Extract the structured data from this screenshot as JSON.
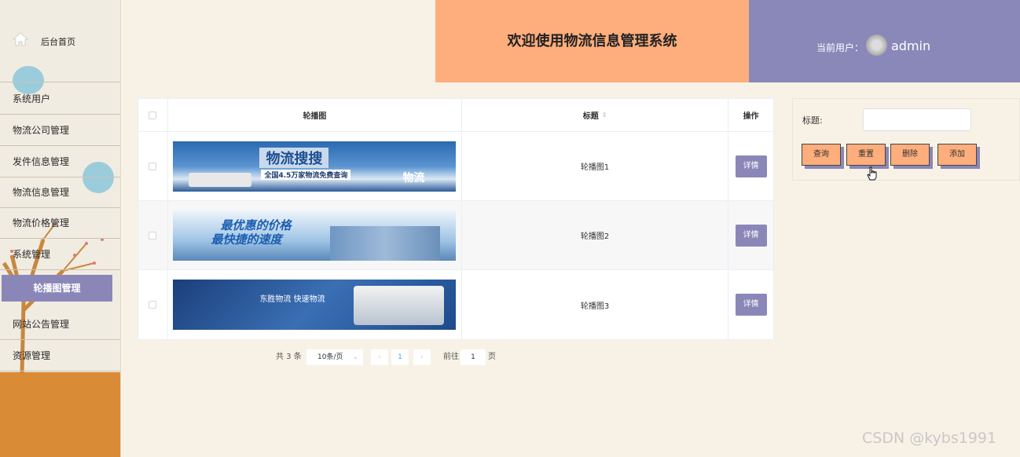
{
  "sidebar": {
    "home_label": "后台首页",
    "items": [
      {
        "label": "系统用户"
      },
      {
        "label": "物流公司管理"
      },
      {
        "label": "发件信息管理"
      },
      {
        "label": "物流信息管理"
      },
      {
        "label": "物流价格管理"
      },
      {
        "label": "系统管理"
      },
      {
        "label": "轮播图管理"
      },
      {
        "label": "网站公告管理"
      },
      {
        "label": "资源管理"
      }
    ]
  },
  "header": {
    "title": "欢迎使用物流信息管理系统",
    "user_label": "当前用户：",
    "username": "admin"
  },
  "table": {
    "columns": {
      "image": "轮播图",
      "title": "标题",
      "action": "操作"
    },
    "rows": [
      {
        "title": "轮播图1",
        "detail": "详情",
        "banner_text": "物流搜搜",
        "banner_sub": "全国4.5万家物流免费查询",
        "banner_tag": "物流"
      },
      {
        "title": "轮播图2",
        "detail": "详情",
        "banner_text": "最优惠的价格",
        "banner_sub": "最快捷的速度",
        "banner_tag": ""
      },
      {
        "title": "轮播图3",
        "detail": "详情",
        "banner_text": "东胜物流 快速物流",
        "banner_sub": "",
        "banner_tag": ""
      }
    ]
  },
  "pagination": {
    "total": "共 3 条",
    "page_size": "10条/页",
    "current_page": "1",
    "goto_label": "前往",
    "goto_value": "1",
    "page_suffix": "页"
  },
  "search": {
    "title_label": "标题:",
    "query": "查询",
    "reset": "重置",
    "delete": "删除",
    "add": "添加"
  },
  "watermark": "CSDN @kybs1991",
  "colors": {
    "accent_purple": "#8a87b8",
    "accent_orange": "#fdae7c",
    "ground": "#d98b35"
  }
}
